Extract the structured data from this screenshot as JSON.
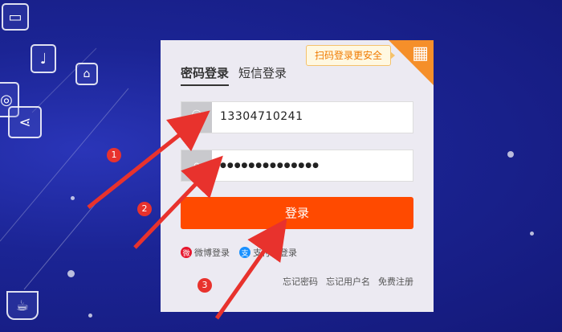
{
  "colors": {
    "accent": "#ff4a00",
    "annotation": "#e8322d",
    "qr": "#f58f2a"
  },
  "panel": {
    "qr_badge": "扫码登录更安全",
    "tabs": [
      {
        "label": "密码登录"
      },
      {
        "label": "短信登录"
      }
    ],
    "username": {
      "value": "13304710241",
      "icon": "user-icon"
    },
    "password": {
      "value": "●●●●●●●●●●●●●●",
      "icon": "lock-icon"
    },
    "login_label": "登录",
    "alt_logins": [
      {
        "label": "微博登录",
        "icon": "weibo-icon"
      },
      {
        "label": "支付宝登录",
        "icon": "alipay-icon"
      }
    ],
    "links": [
      {
        "label": "忘记密码"
      },
      {
        "label": "忘记用户名"
      },
      {
        "label": "免费注册"
      }
    ]
  },
  "annotations": {
    "step1": "1",
    "step2": "2",
    "step3": "3"
  }
}
